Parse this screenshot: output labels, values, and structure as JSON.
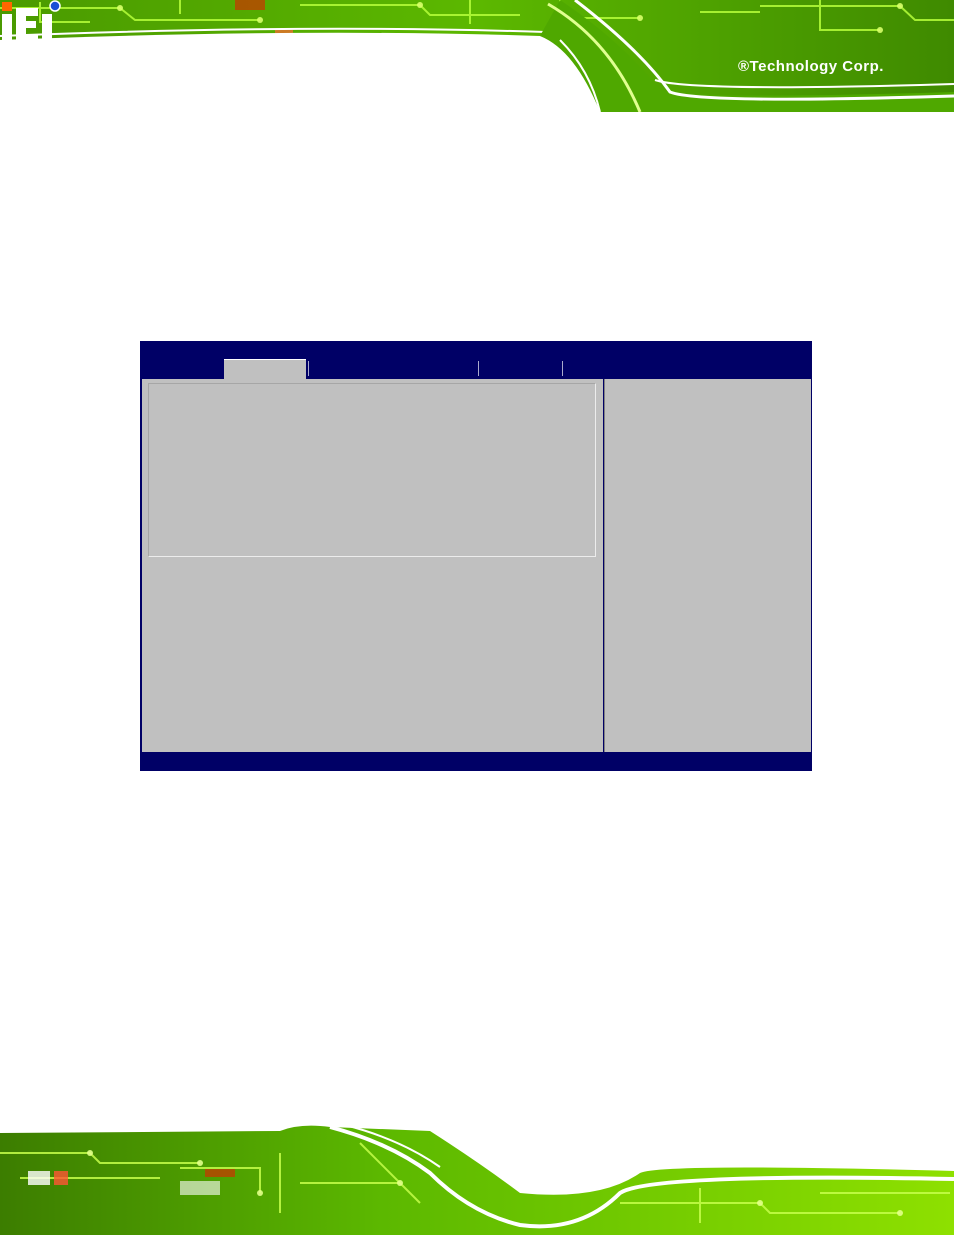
{
  "header": {
    "brand_logo_text": "iEi",
    "brand_text": "®Technology Corp."
  },
  "bios": {
    "title": "",
    "tabs": [
      {
        "label": "",
        "active": false
      },
      {
        "label": "",
        "active": true
      },
      {
        "label": "",
        "active": false
      },
      {
        "label": "",
        "active": false
      },
      {
        "label": "",
        "active": false
      }
    ],
    "footer": ""
  },
  "colors": {
    "bios_blue": "#000066",
    "bios_gray": "#c0c0c0",
    "pcb_green": "#66cc00",
    "pcb_bright": "#a8ff2a"
  }
}
